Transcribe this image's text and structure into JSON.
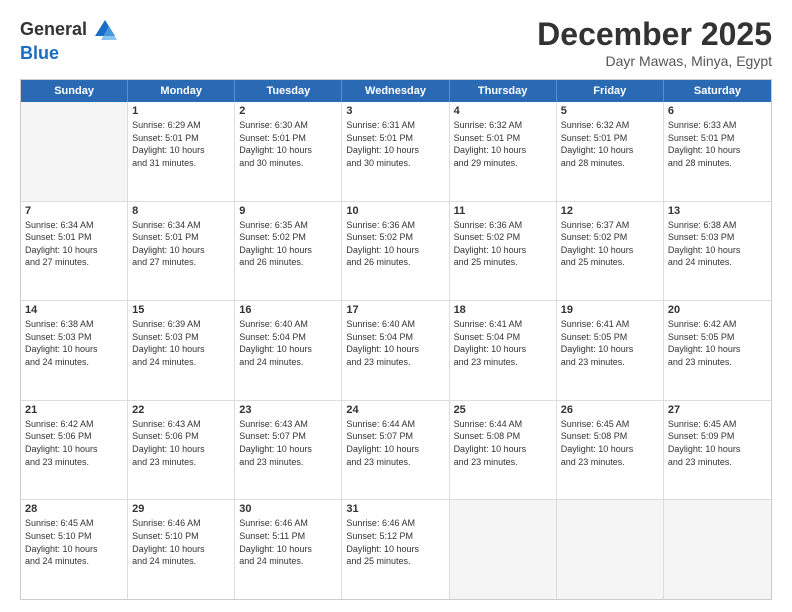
{
  "logo": {
    "general": "General",
    "blue": "Blue"
  },
  "title": "December 2025",
  "location": "Dayr Mawas, Minya, Egypt",
  "days": [
    "Sunday",
    "Monday",
    "Tuesday",
    "Wednesday",
    "Thursday",
    "Friday",
    "Saturday"
  ],
  "rows": [
    [
      {
        "day": "",
        "info": ""
      },
      {
        "day": "1",
        "info": "Sunrise: 6:29 AM\nSunset: 5:01 PM\nDaylight: 10 hours\nand 31 minutes."
      },
      {
        "day": "2",
        "info": "Sunrise: 6:30 AM\nSunset: 5:01 PM\nDaylight: 10 hours\nand 30 minutes."
      },
      {
        "day": "3",
        "info": "Sunrise: 6:31 AM\nSunset: 5:01 PM\nDaylight: 10 hours\nand 30 minutes."
      },
      {
        "day": "4",
        "info": "Sunrise: 6:32 AM\nSunset: 5:01 PM\nDaylight: 10 hours\nand 29 minutes."
      },
      {
        "day": "5",
        "info": "Sunrise: 6:32 AM\nSunset: 5:01 PM\nDaylight: 10 hours\nand 28 minutes."
      },
      {
        "day": "6",
        "info": "Sunrise: 6:33 AM\nSunset: 5:01 PM\nDaylight: 10 hours\nand 28 minutes."
      }
    ],
    [
      {
        "day": "7",
        "info": "Sunrise: 6:34 AM\nSunset: 5:01 PM\nDaylight: 10 hours\nand 27 minutes."
      },
      {
        "day": "8",
        "info": "Sunrise: 6:34 AM\nSunset: 5:01 PM\nDaylight: 10 hours\nand 27 minutes."
      },
      {
        "day": "9",
        "info": "Sunrise: 6:35 AM\nSunset: 5:02 PM\nDaylight: 10 hours\nand 26 minutes."
      },
      {
        "day": "10",
        "info": "Sunrise: 6:36 AM\nSunset: 5:02 PM\nDaylight: 10 hours\nand 26 minutes."
      },
      {
        "day": "11",
        "info": "Sunrise: 6:36 AM\nSunset: 5:02 PM\nDaylight: 10 hours\nand 25 minutes."
      },
      {
        "day": "12",
        "info": "Sunrise: 6:37 AM\nSunset: 5:02 PM\nDaylight: 10 hours\nand 25 minutes."
      },
      {
        "day": "13",
        "info": "Sunrise: 6:38 AM\nSunset: 5:03 PM\nDaylight: 10 hours\nand 24 minutes."
      }
    ],
    [
      {
        "day": "14",
        "info": "Sunrise: 6:38 AM\nSunset: 5:03 PM\nDaylight: 10 hours\nand 24 minutes."
      },
      {
        "day": "15",
        "info": "Sunrise: 6:39 AM\nSunset: 5:03 PM\nDaylight: 10 hours\nand 24 minutes."
      },
      {
        "day": "16",
        "info": "Sunrise: 6:40 AM\nSunset: 5:04 PM\nDaylight: 10 hours\nand 24 minutes."
      },
      {
        "day": "17",
        "info": "Sunrise: 6:40 AM\nSunset: 5:04 PM\nDaylight: 10 hours\nand 23 minutes."
      },
      {
        "day": "18",
        "info": "Sunrise: 6:41 AM\nSunset: 5:04 PM\nDaylight: 10 hours\nand 23 minutes."
      },
      {
        "day": "19",
        "info": "Sunrise: 6:41 AM\nSunset: 5:05 PM\nDaylight: 10 hours\nand 23 minutes."
      },
      {
        "day": "20",
        "info": "Sunrise: 6:42 AM\nSunset: 5:05 PM\nDaylight: 10 hours\nand 23 minutes."
      }
    ],
    [
      {
        "day": "21",
        "info": "Sunrise: 6:42 AM\nSunset: 5:06 PM\nDaylight: 10 hours\nand 23 minutes."
      },
      {
        "day": "22",
        "info": "Sunrise: 6:43 AM\nSunset: 5:06 PM\nDaylight: 10 hours\nand 23 minutes."
      },
      {
        "day": "23",
        "info": "Sunrise: 6:43 AM\nSunset: 5:07 PM\nDaylight: 10 hours\nand 23 minutes."
      },
      {
        "day": "24",
        "info": "Sunrise: 6:44 AM\nSunset: 5:07 PM\nDaylight: 10 hours\nand 23 minutes."
      },
      {
        "day": "25",
        "info": "Sunrise: 6:44 AM\nSunset: 5:08 PM\nDaylight: 10 hours\nand 23 minutes."
      },
      {
        "day": "26",
        "info": "Sunrise: 6:45 AM\nSunset: 5:08 PM\nDaylight: 10 hours\nand 23 minutes."
      },
      {
        "day": "27",
        "info": "Sunrise: 6:45 AM\nSunset: 5:09 PM\nDaylight: 10 hours\nand 23 minutes."
      }
    ],
    [
      {
        "day": "28",
        "info": "Sunrise: 6:45 AM\nSunset: 5:10 PM\nDaylight: 10 hours\nand 24 minutes."
      },
      {
        "day": "29",
        "info": "Sunrise: 6:46 AM\nSunset: 5:10 PM\nDaylight: 10 hours\nand 24 minutes."
      },
      {
        "day": "30",
        "info": "Sunrise: 6:46 AM\nSunset: 5:11 PM\nDaylight: 10 hours\nand 24 minutes."
      },
      {
        "day": "31",
        "info": "Sunrise: 6:46 AM\nSunset: 5:12 PM\nDaylight: 10 hours\nand 25 minutes."
      },
      {
        "day": "",
        "info": ""
      },
      {
        "day": "",
        "info": ""
      },
      {
        "day": "",
        "info": ""
      }
    ]
  ]
}
